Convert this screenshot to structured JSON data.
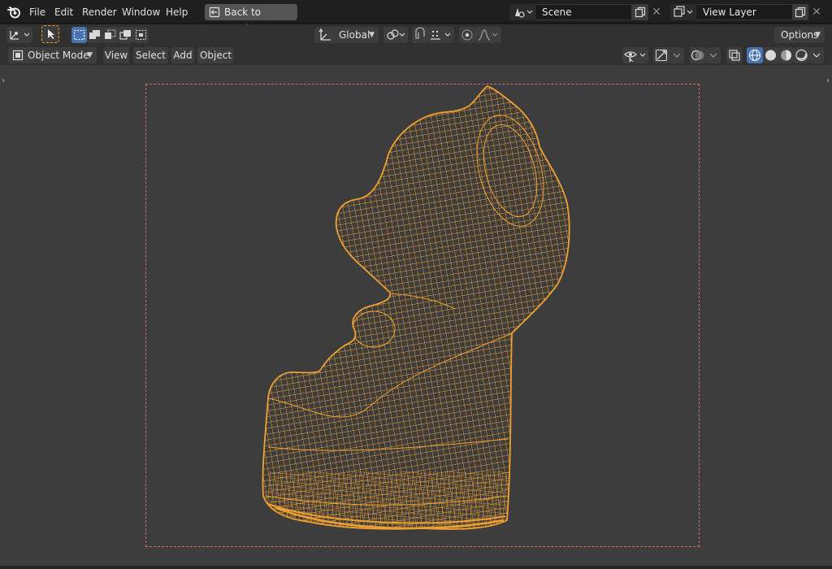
{
  "menu": {
    "items": [
      "File",
      "Edit",
      "Render",
      "Window",
      "Help"
    ],
    "back_button": "Back to Previous"
  },
  "scene": {
    "name": "Scene",
    "view_layer": "View Layer"
  },
  "tool_header": {
    "orientation": "Global",
    "options_label": "Options"
  },
  "viewport_header": {
    "mode": "Object Mode",
    "menus": [
      "View",
      "Select",
      "Add",
      "Object"
    ]
  },
  "colors": {
    "wireframe": "#f0a030",
    "camera_frame": "#d46a6a",
    "viewport_bg": "#3d3d3d",
    "header_bg": "#303030",
    "accent": "#4772b3"
  },
  "icons": {
    "logo": "blender-logo-icon",
    "back": "back-to-previous-icon",
    "scene": "scene-icon",
    "view_layer": "view-layer-icon",
    "duplicate": "duplicate-icon",
    "remove": "close-icon"
  }
}
